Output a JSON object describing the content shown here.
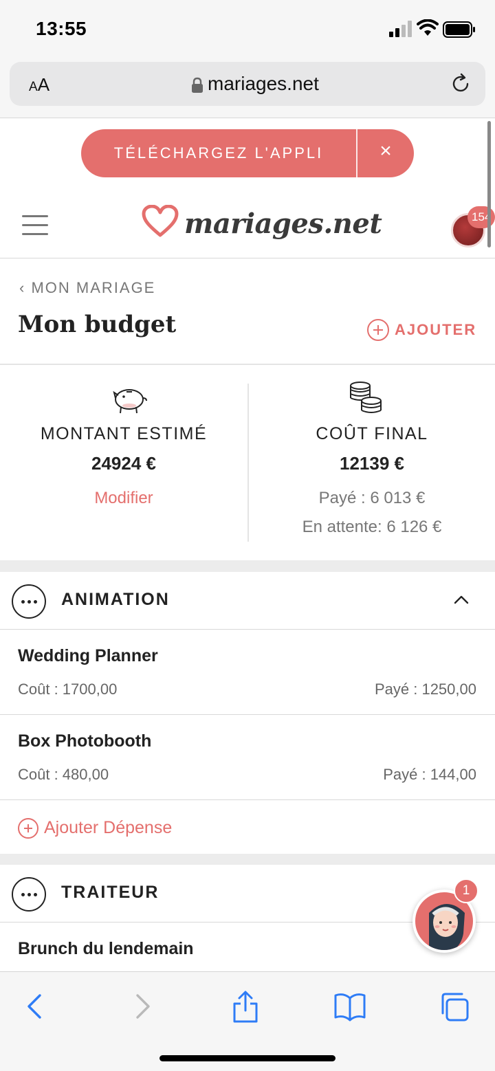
{
  "status_bar": {
    "time": "13:55"
  },
  "browser": {
    "aa_label_small": "A",
    "aa_label_large": "A",
    "url": "mariages.net"
  },
  "app_banner": {
    "cta": "TÉLÉCHARGEZ L'APPLI",
    "close": "×"
  },
  "header": {
    "logo_text": "mariages.net",
    "notification_count": "154"
  },
  "page": {
    "breadcrumb": "MON MARIAGE",
    "title": "Mon budget",
    "add_label": "AJOUTER"
  },
  "summary": {
    "estimated": {
      "label": "MONTANT ESTIMÉ",
      "value": "24924 €",
      "link": "Modifier"
    },
    "final": {
      "label": "COÛT FINAL",
      "value": "12139 €",
      "paid": "Payé : 6 013 €",
      "pending": "En attente: 6 126 €"
    }
  },
  "categories": [
    {
      "title": "ANIMATION",
      "expenses": [
        {
          "name": "Wedding Planner",
          "cost": "Coût : 1700,00",
          "paid": "Payé : 1250,00"
        },
        {
          "name": "Box Photobooth",
          "cost": "Coût : 480,00",
          "paid": "Payé : 144,00"
        }
      ],
      "add_expense": "Ajouter Dépense"
    },
    {
      "title": "TRAITEUR",
      "expenses": [
        {
          "name": "Brunch du lendemain"
        }
      ]
    }
  ],
  "assistant": {
    "badge": "1"
  },
  "colors": {
    "accent": "#e46f6d",
    "ios_blue": "#2e7cf6"
  },
  "icons": {
    "piggy": "piggy-bank-icon",
    "coins": "coin-stack-icon",
    "more": "more-dots-icon",
    "chevron": "chevron-up-icon"
  }
}
